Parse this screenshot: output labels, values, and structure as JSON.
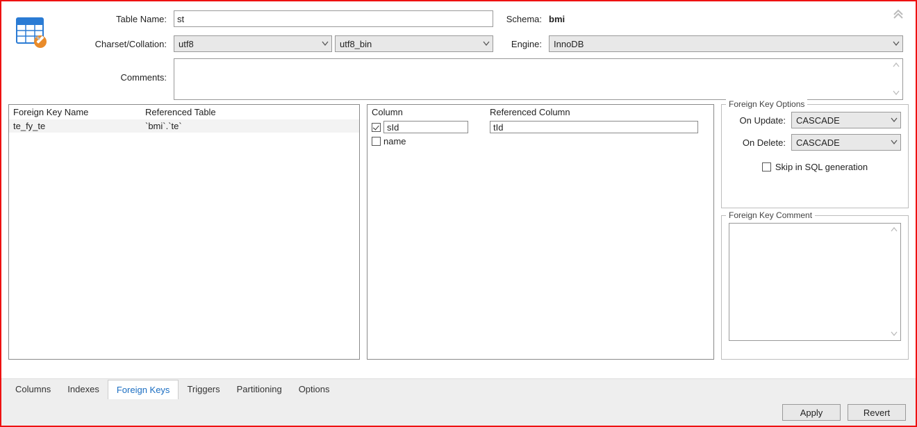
{
  "header": {
    "table_name_label": "Table Name:",
    "table_name_value": "st",
    "schema_label": "Schema:",
    "schema_value": "bmi",
    "charset_label": "Charset/Collation:",
    "charset_value": "utf8",
    "collation_value": "utf8_bin",
    "engine_label": "Engine:",
    "engine_value": "InnoDB",
    "comments_label": "Comments:",
    "comments_value": ""
  },
  "fk_list": {
    "col_fk_name": "Foreign Key Name",
    "col_ref_table": "Referenced Table",
    "rows": [
      {
        "name": "te_fy_te",
        "ref": "`bmi`.`te`"
      }
    ]
  },
  "fk_cols": {
    "col_column": "Column",
    "col_ref_col": "Referenced Column",
    "rows": [
      {
        "checked": true,
        "col": "sId",
        "ref": "tId"
      },
      {
        "checked": false,
        "col": "name",
        "ref": ""
      }
    ]
  },
  "fk_options": {
    "legend": "Foreign Key Options",
    "on_update_label": "On Update:",
    "on_update_value": "CASCADE",
    "on_delete_label": "On Delete:",
    "on_delete_value": "CASCADE",
    "skip_label": "Skip in SQL generation"
  },
  "fk_comment": {
    "legend": "Foreign Key Comment",
    "value": ""
  },
  "tabs": {
    "items": [
      "Columns",
      "Indexes",
      "Foreign Keys",
      "Triggers",
      "Partitioning",
      "Options"
    ],
    "active_index": 2
  },
  "buttons": {
    "apply": "Apply",
    "revert": "Revert"
  }
}
